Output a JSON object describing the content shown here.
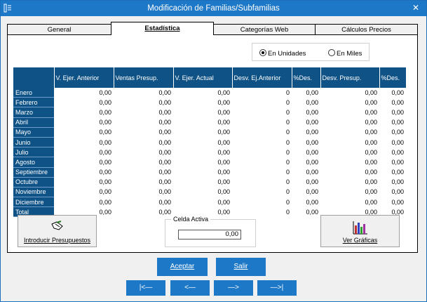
{
  "window": {
    "title": "Modificación de Familias/Subfamilias"
  },
  "tabs": [
    {
      "label": "General",
      "active": false
    },
    {
      "label": "Estadística",
      "active": true
    },
    {
      "label": "Categorías Web",
      "active": false
    },
    {
      "label": "Cálculos Precios",
      "active": false
    }
  ],
  "units": {
    "option1": "En Unidades",
    "option2": "En Miles",
    "selected": "option1"
  },
  "table": {
    "columns": [
      "V. Ejer. Anterior",
      "Ventas Presup.",
      "V. Ejer. Actual",
      "Desv. Ej.Anterior",
      "%Des.",
      "Desv. Presup.",
      "%Des."
    ],
    "rows": [
      {
        "label": "Enero",
        "values": [
          "0,00",
          "0,00",
          "0,00",
          "0",
          "0,00",
          "0,00",
          "0,00"
        ]
      },
      {
        "label": "Febrero",
        "values": [
          "0,00",
          "0,00",
          "0,00",
          "0",
          "0,00",
          "0,00",
          "0,00"
        ]
      },
      {
        "label": "Marzo",
        "values": [
          "0,00",
          "0,00",
          "0,00",
          "0",
          "0,00",
          "0,00",
          "0,00"
        ]
      },
      {
        "label": "Abril",
        "values": [
          "0,00",
          "0,00",
          "0,00",
          "0",
          "0,00",
          "0,00",
          "0,00"
        ]
      },
      {
        "label": "Mayo",
        "values": [
          "0,00",
          "0,00",
          "0,00",
          "0",
          "0,00",
          "0,00",
          "0,00"
        ]
      },
      {
        "label": "Junio",
        "values": [
          "0,00",
          "0,00",
          "0,00",
          "0",
          "0,00",
          "0,00",
          "0,00"
        ]
      },
      {
        "label": "Julio",
        "values": [
          "0,00",
          "0,00",
          "0,00",
          "0",
          "0,00",
          "0,00",
          "0,00"
        ]
      },
      {
        "label": "Agosto",
        "values": [
          "0,00",
          "0,00",
          "0,00",
          "0",
          "0,00",
          "0,00",
          "0,00"
        ]
      },
      {
        "label": "Septiembre",
        "values": [
          "0,00",
          "0,00",
          "0,00",
          "0",
          "0,00",
          "0,00",
          "0,00"
        ]
      },
      {
        "label": "Octubre",
        "values": [
          "0,00",
          "0,00",
          "0,00",
          "0",
          "0,00",
          "0,00",
          "0,00"
        ]
      },
      {
        "label": "Noviembre",
        "values": [
          "0,00",
          "0,00",
          "0,00",
          "0",
          "0,00",
          "0,00",
          "0,00"
        ]
      },
      {
        "label": "Diciembre",
        "values": [
          "0,00",
          "0,00",
          "0,00",
          "0",
          "0,00",
          "0,00",
          "0,00"
        ]
      },
      {
        "label": "Total",
        "values": [
          "0,00",
          "0,00",
          "0,00",
          "0",
          "0,00",
          "0,00",
          "0,00"
        ]
      }
    ]
  },
  "buttons": {
    "introducir": "Introducir Presupuestos",
    "graficas": "Ver Gráficas",
    "aceptar": "Aceptar",
    "salir": "Salir",
    "first": "|<—",
    "prev": "<—",
    "next": "—>",
    "last": "—>|"
  },
  "celda": {
    "label": "Celda Activa",
    "value": "0,00"
  },
  "colors": {
    "header_bg": "#0f5286",
    "accent": "#1e78c8"
  }
}
